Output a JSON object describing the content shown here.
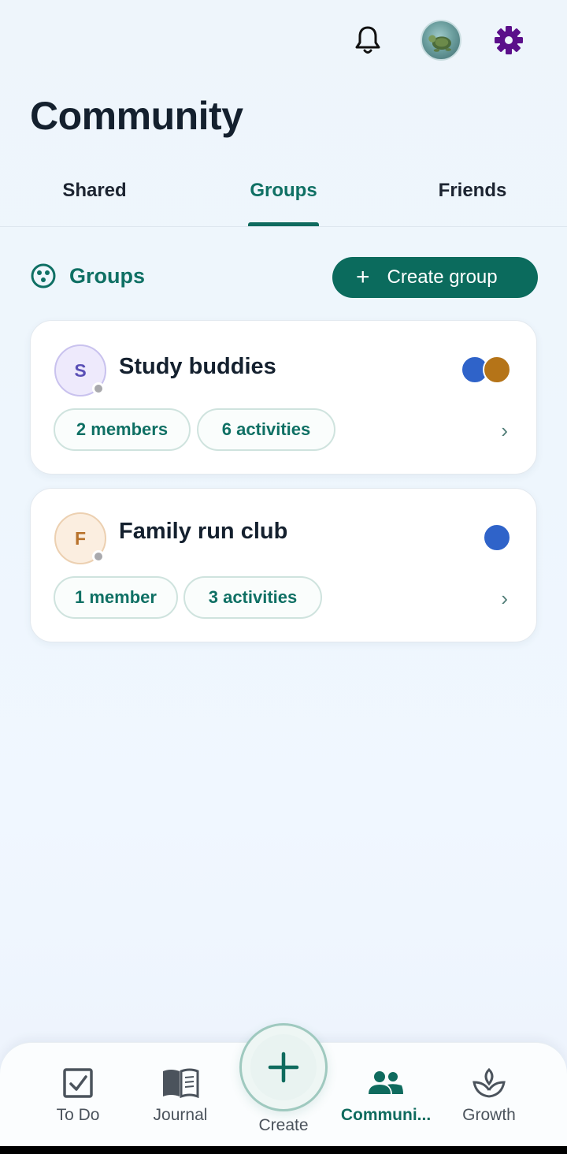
{
  "header": {
    "title": "Community",
    "notifications_icon": "bell-icon",
    "settings_icon": "gear-icon",
    "colors": {
      "settings": "#5b0f8a",
      "accent": "#0f6b5e"
    }
  },
  "tabs": [
    {
      "label": "Shared",
      "active": false
    },
    {
      "label": "Groups",
      "active": true
    },
    {
      "label": "Friends",
      "active": false
    }
  ],
  "groups_section": {
    "title": "Groups",
    "create_button": {
      "icon": "+",
      "label": "Create group"
    }
  },
  "groups": [
    {
      "initial": "S",
      "name": "Study buddies",
      "members_label": "2 members",
      "activities_label": "6 activities",
      "member_colors": [
        "#2f63c9",
        "#b57418"
      ]
    },
    {
      "initial": "F",
      "name": "Family run club",
      "members_label": "1 member",
      "activities_label": "3 activities",
      "member_colors": [
        "#2f63c9"
      ]
    }
  ],
  "bottom_nav": {
    "items": [
      {
        "label": "To Do",
        "icon": "checkbox-icon"
      },
      {
        "label": "Journal",
        "icon": "book-icon"
      },
      {
        "label": "Create",
        "icon": "plus-icon"
      },
      {
        "label": "Communi...",
        "icon": "people-icon",
        "active": true
      },
      {
        "label": "Growth",
        "icon": "sprout-icon"
      }
    ]
  }
}
